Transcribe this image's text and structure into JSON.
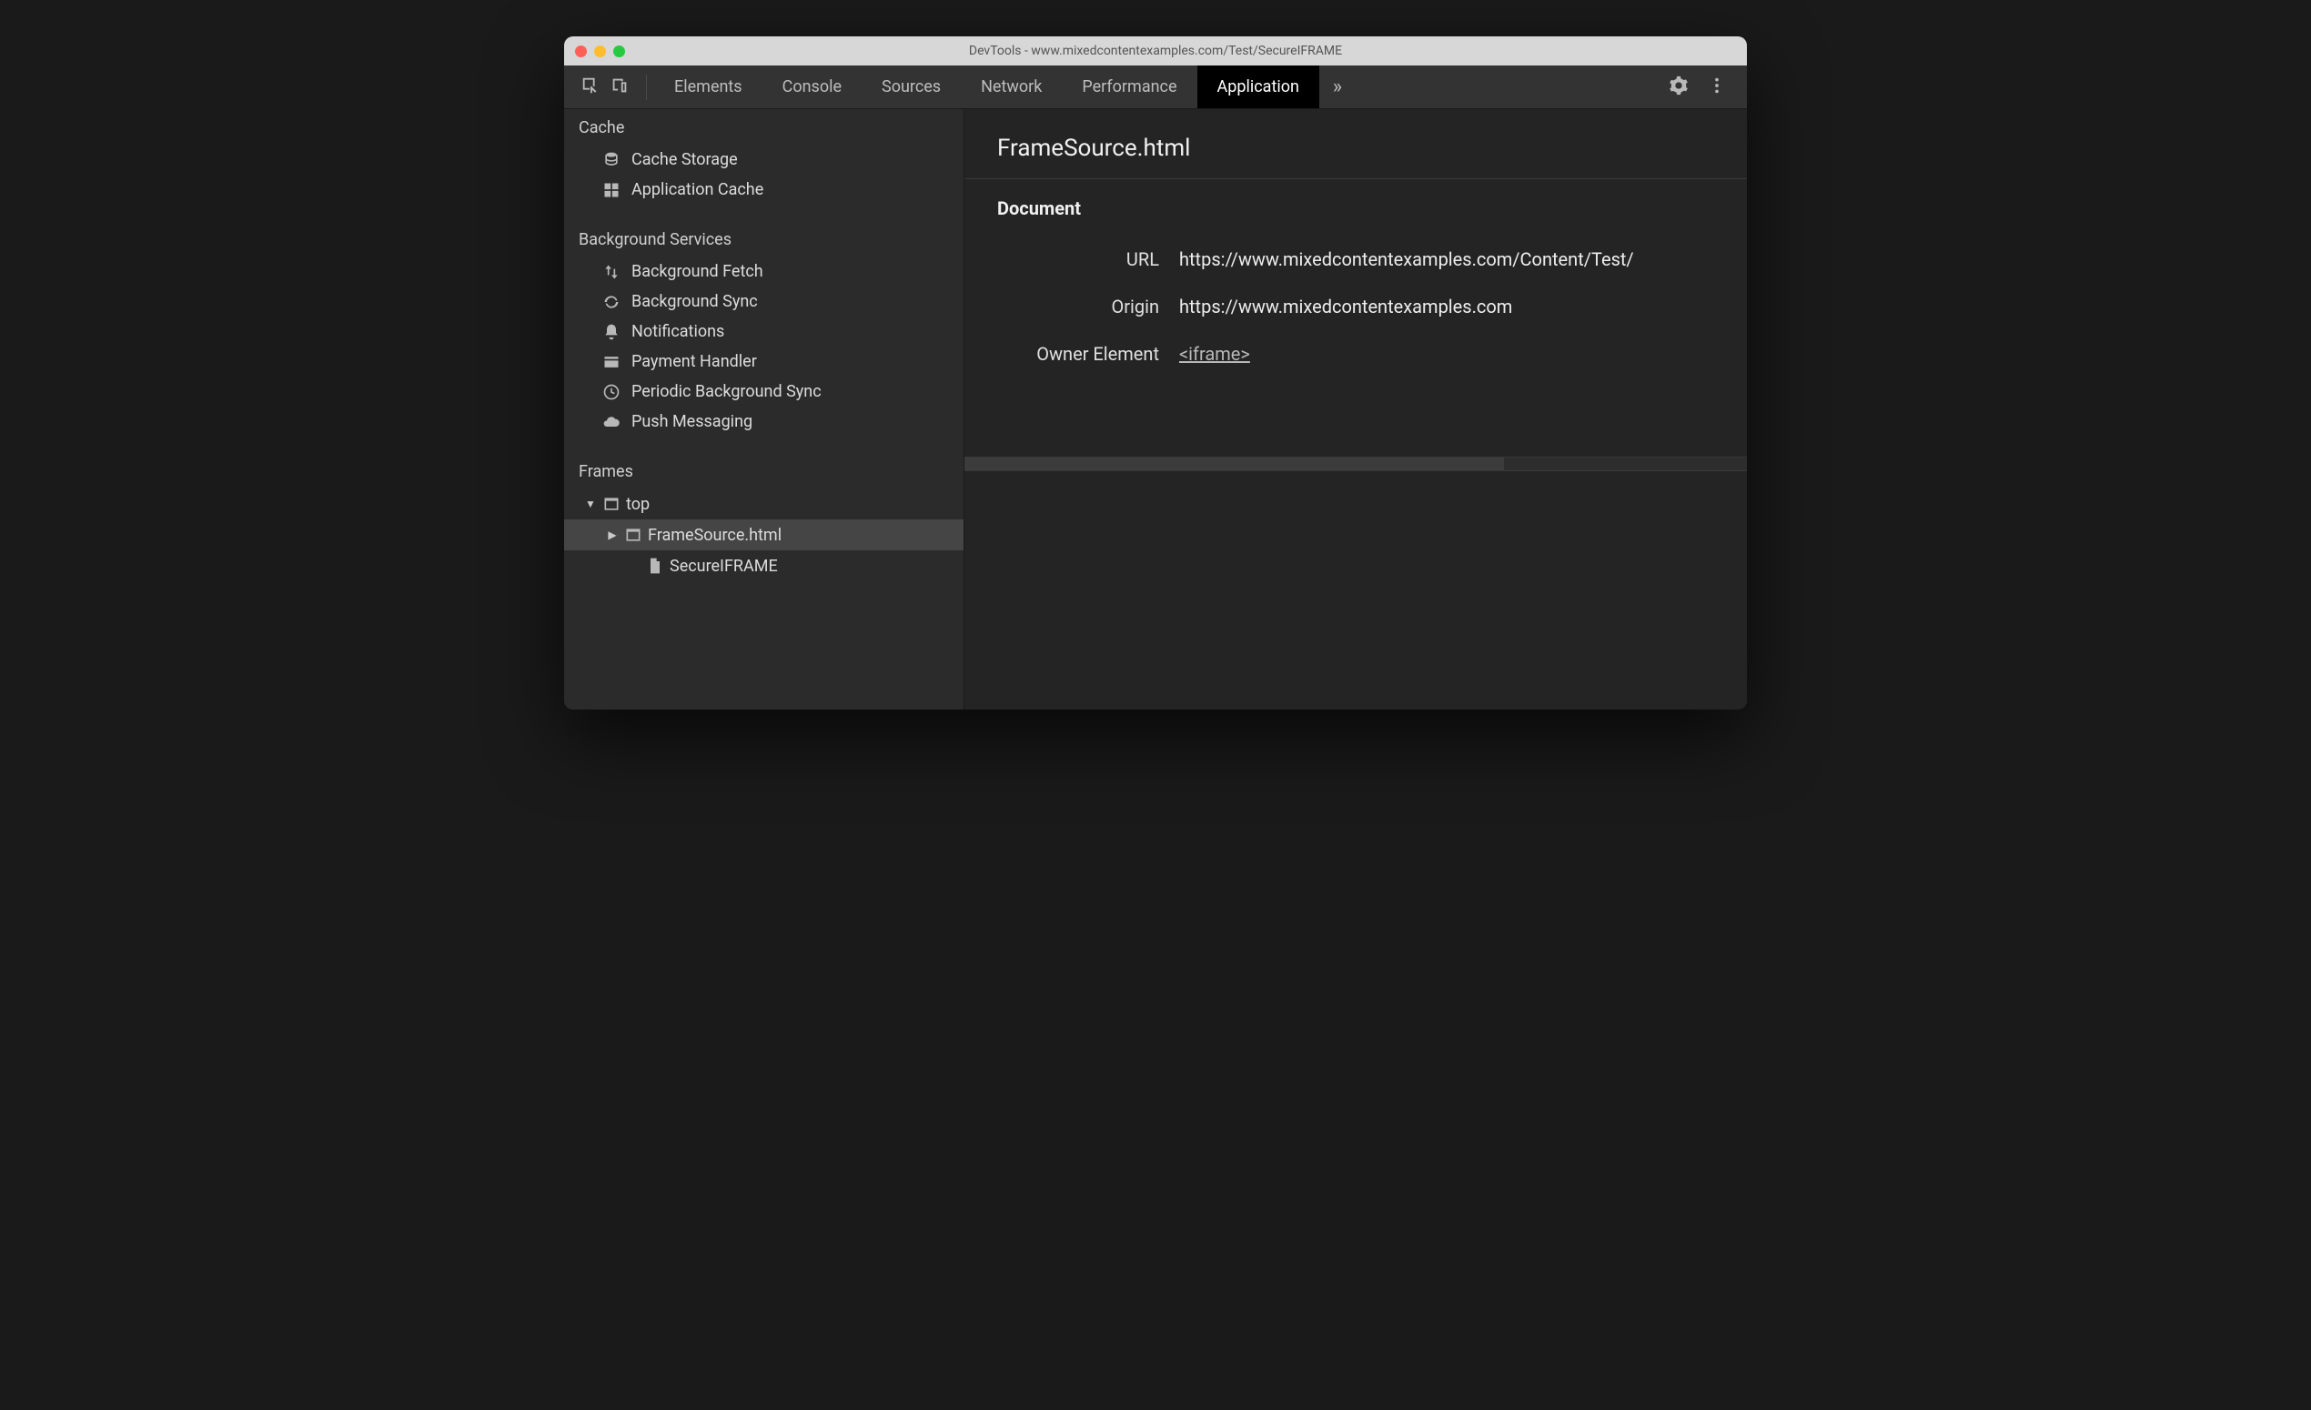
{
  "window": {
    "title": "DevTools - www.mixedcontentexamples.com/Test/SecureIFRAME"
  },
  "toolbar": {
    "tabs": [
      "Elements",
      "Console",
      "Sources",
      "Network",
      "Performance",
      "Application"
    ],
    "active_tab": "Application"
  },
  "sidebar": {
    "groups": [
      {
        "header": "Cache",
        "items": [
          {
            "icon": "database",
            "label": "Cache Storage"
          },
          {
            "icon": "grid",
            "label": "Application Cache"
          }
        ]
      },
      {
        "header": "Background Services",
        "items": [
          {
            "icon": "arrows-updown",
            "label": "Background Fetch"
          },
          {
            "icon": "sync",
            "label": "Background Sync"
          },
          {
            "icon": "bell",
            "label": "Notifications"
          },
          {
            "icon": "card",
            "label": "Payment Handler"
          },
          {
            "icon": "clock",
            "label": "Periodic Background Sync"
          },
          {
            "icon": "cloud",
            "label": "Push Messaging"
          }
        ]
      },
      {
        "header": "Frames",
        "tree": {
          "label": "top",
          "children": [
            {
              "label": "FrameSource.html",
              "selected": true,
              "expandable": true
            },
            {
              "label": "SecureIFRAME",
              "icon": "file"
            }
          ]
        }
      }
    ]
  },
  "main": {
    "title": "FrameSource.html",
    "section": "Document",
    "rows": [
      {
        "k": "URL",
        "v": "https://www.mixedcontentexamples.com/Content/Test/"
      },
      {
        "k": "Origin",
        "v": "https://www.mixedcontentexamples.com"
      },
      {
        "k": "Owner Element",
        "v": "<iframe>",
        "link": true
      }
    ]
  }
}
